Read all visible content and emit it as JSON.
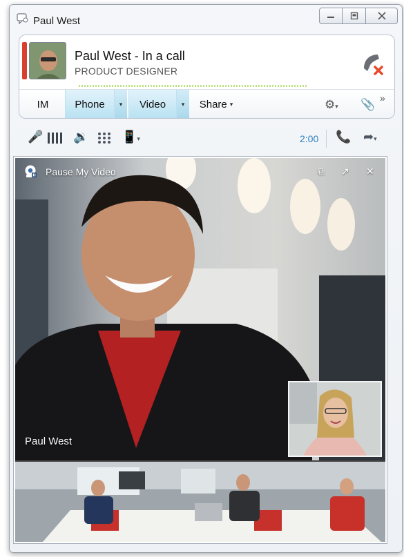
{
  "window": {
    "title": "Paul West",
    "buttons": [
      "minimize",
      "restore",
      "close"
    ]
  },
  "contact": {
    "name_status": "Paul West - In a call",
    "job_title": "PRODUCT DESIGNER",
    "status_color": "#d7402e"
  },
  "tabs": [
    {
      "label": "IM",
      "active": false
    },
    {
      "label": "Phone",
      "active": true
    },
    {
      "label": "Video",
      "active": true
    },
    {
      "label": "Share",
      "active": false
    }
  ],
  "toolbar_icons": [
    "participants-icon",
    "attachment-icon",
    "more-icon"
  ],
  "call_controls": {
    "icons": [
      "mute-icon",
      "hold-icon",
      "volume-icon",
      "dialpad-icon",
      "devices-icon"
    ],
    "duration": "2:00",
    "right_icons": [
      "hold-call-icon",
      "transfer-icon"
    ]
  },
  "video": {
    "pause_label": "Pause My Video",
    "window_buttons": [
      "pop-out-icon",
      "expand-icon",
      "close-icon"
    ],
    "speaker_name": "Paul West"
  },
  "colors": {
    "accent": "#2b7fc3",
    "tab_active": "#b8e1f2",
    "hangup_red": "#e8492c"
  }
}
